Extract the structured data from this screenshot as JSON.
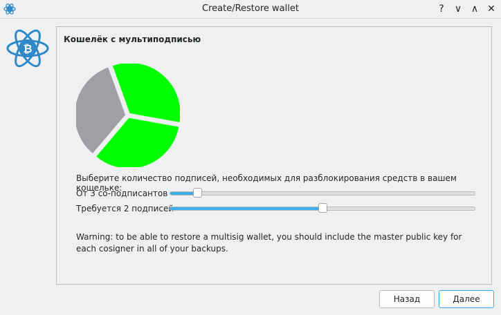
{
  "window": {
    "title": "Create/Restore wallet",
    "help_label": "?",
    "minimize_label": "∨",
    "maximize_label": "∧",
    "close_label": "✕"
  },
  "logo": {
    "icon": "electrum-bitcoin-atom-icon"
  },
  "panel": {
    "heading": "Кошелёк с мультиподписью",
    "instruction": "Выберите количество подписей, необходимых для разблокирования средств в вашем кошельке:",
    "cosigners": {
      "label": "От 3 со-подписантов",
      "value": 3,
      "min": 2,
      "max": 15
    },
    "required": {
      "label": "Требуется 2 подписей",
      "value": 2,
      "min": 1,
      "max": 3
    },
    "warning": "Warning: to be able to restore a multisig wallet, you should include the master public key for each cosigner in all of your backups."
  },
  "pie": {
    "slices": [
      {
        "state": "required",
        "color": "#00ff00"
      },
      {
        "state": "required",
        "color": "#00ff00"
      },
      {
        "state": "optional",
        "color": "#a0a0a4"
      }
    ]
  },
  "buttons": {
    "back": "Назад",
    "next": "Далее"
  },
  "colors": {
    "accent": "#3daee9",
    "green": "#00ff00",
    "grey": "#a0a0a4"
  }
}
